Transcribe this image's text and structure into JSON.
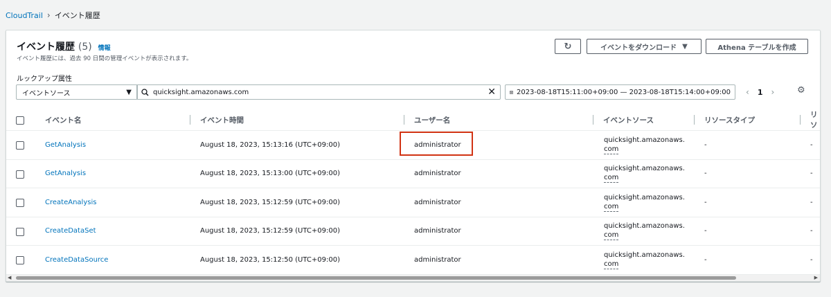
{
  "breadcrumb": {
    "root": "CloudTrail",
    "current": "イベント履歴"
  },
  "header": {
    "title": "イベント履歴",
    "count": "(5)",
    "info": "情報",
    "description": "イベント履歴には、過去 90 日間の管理イベントが表示されます。"
  },
  "toolbar": {
    "refresh_icon": "↻",
    "download_label": "イベントをダウンロード",
    "download_caret": "▼",
    "athena_label": "Athena テーブルを作成"
  },
  "filter": {
    "lookup_label": "ルックアップ属性",
    "attribute": "イベントソース",
    "attribute_caret": "▼",
    "search_value": "quicksight.amazonaws.com",
    "search_icon": "search-icon",
    "date_range": "2023-08-18T15:11:00+09:00 — 2023-08-18T15:14:00+09:00"
  },
  "pagination": {
    "page": "1",
    "prev": "‹",
    "next": "›"
  },
  "columns": [
    "イベント名",
    "イベント時間",
    "ユーザー名",
    "イベントソース",
    "リソースタイプ",
    "リソ"
  ],
  "rows": [
    {
      "event": "GetAnalysis",
      "time": "August 18, 2023, 15:13:16 (UTC+09:00)",
      "user": "administrator",
      "source1": "quicksight.amazonaws.",
      "source2": "com",
      "rtype": "-",
      "extra": "-"
    },
    {
      "event": "GetAnalysis",
      "time": "August 18, 2023, 15:13:00 (UTC+09:00)",
      "user": "administrator",
      "source1": "quicksight.amazonaws.",
      "source2": "com",
      "rtype": "-",
      "extra": "-"
    },
    {
      "event": "CreateAnalysis",
      "time": "August 18, 2023, 15:12:59 (UTC+09:00)",
      "user": "administrator",
      "source1": "quicksight.amazonaws.",
      "source2": "com",
      "rtype": "-",
      "extra": "-"
    },
    {
      "event": "CreateDataSet",
      "time": "August 18, 2023, 15:12:59 (UTC+09:00)",
      "user": "administrator",
      "source1": "quicksight.amazonaws.",
      "source2": "com",
      "rtype": "-",
      "extra": "-"
    },
    {
      "event": "CreateDataSource",
      "time": "August 18, 2023, 15:12:50 (UTC+09:00)",
      "user": "administrator",
      "source1": "quicksight.amazonaws.",
      "source2": "com",
      "rtype": "-",
      "extra": "-"
    }
  ],
  "colors": {
    "link": "#0073bb",
    "highlight": "#d13212"
  }
}
